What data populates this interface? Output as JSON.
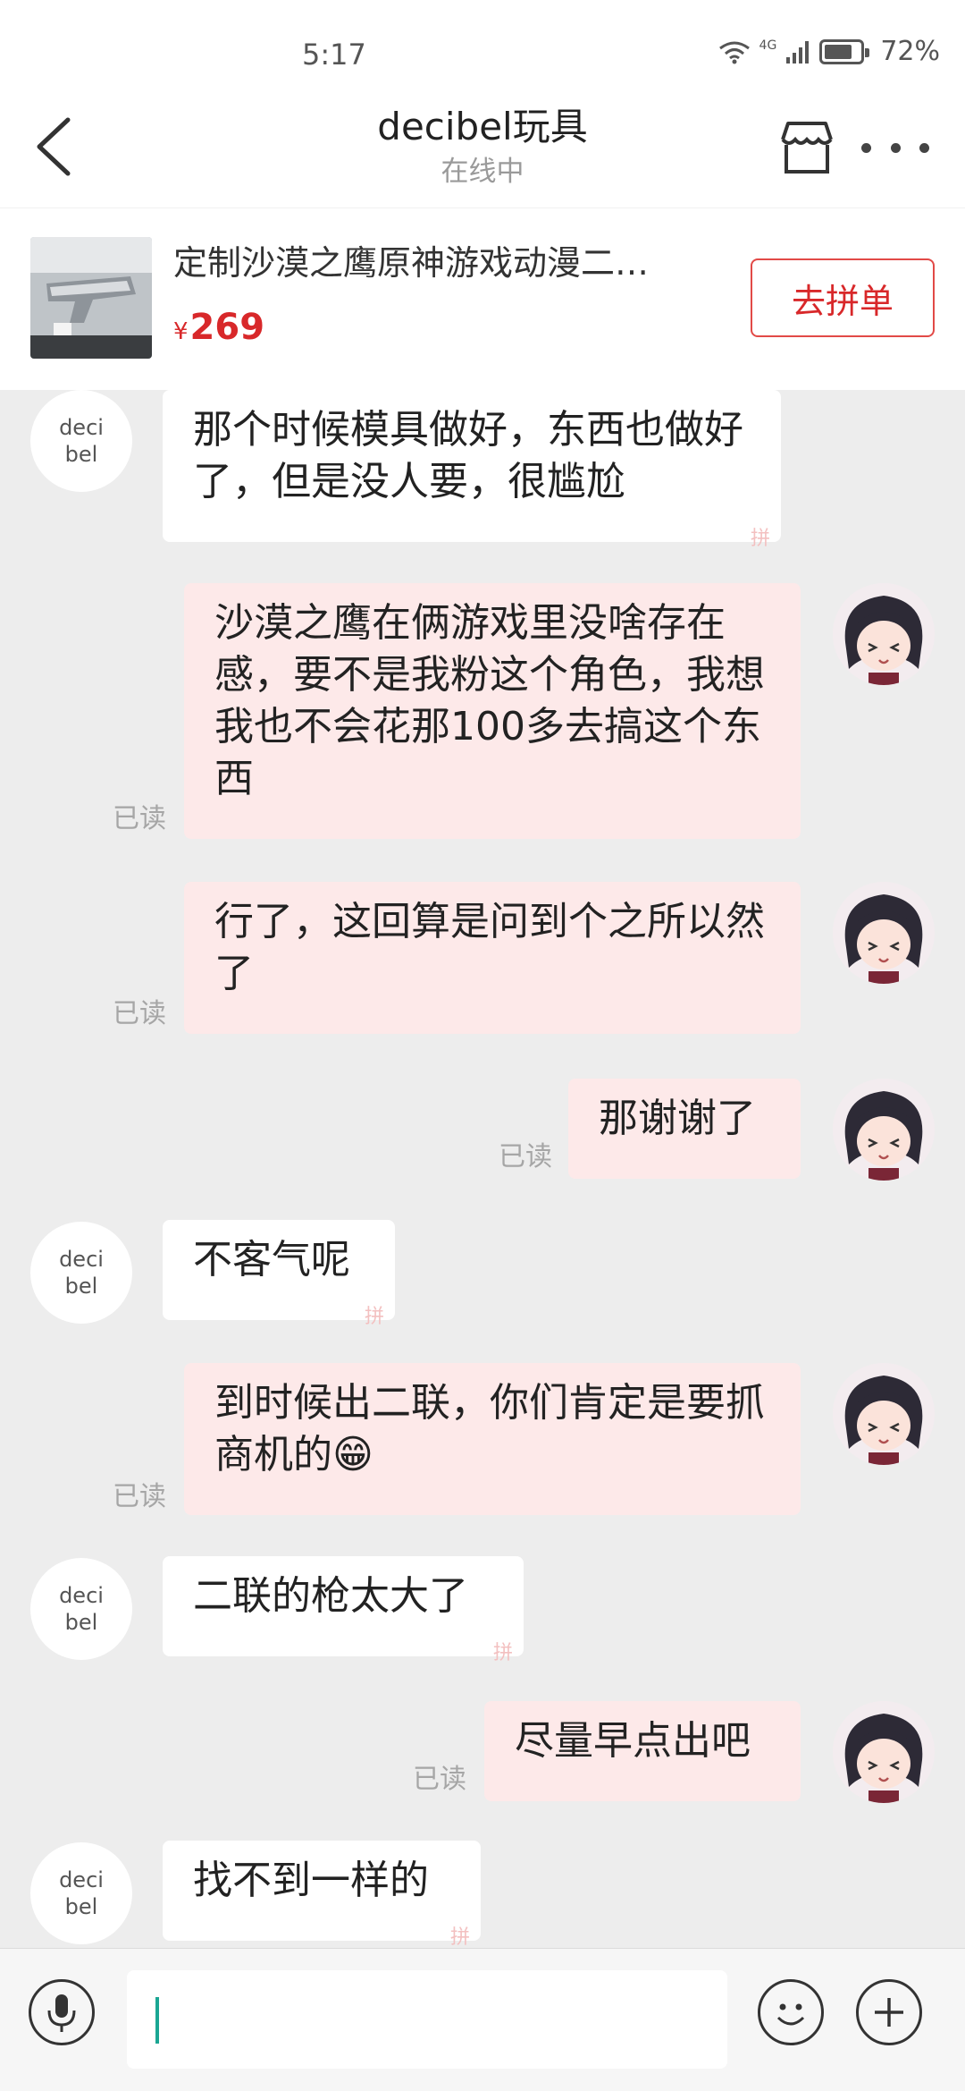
{
  "status_bar": {
    "time": "5:17",
    "network": "4G",
    "battery": "72%"
  },
  "header": {
    "title": "decibel玩具",
    "subtitle": "在线中"
  },
  "product": {
    "name": "定制沙漠之鹰原神游戏动漫二…",
    "currency": "¥",
    "price": "269",
    "button": "去拼单"
  },
  "contact": {
    "avatar_text_line1": "deci",
    "avatar_text_line2": "bel"
  },
  "messages": [
    {
      "side": "in",
      "text": "那个时候模具做好，东西也做好了，但是没人要，很尴尬"
    },
    {
      "side": "out",
      "text": "沙漠之鹰在俩游戏里没啥存在感，要不是我粉这个角色，我想我也不会花那100多去搞这个东西",
      "status": "已读"
    },
    {
      "side": "out",
      "text": "行了，这回算是问到个之所以然了",
      "status": "已读"
    },
    {
      "side": "out",
      "text": "那谢谢了",
      "status": "已读"
    },
    {
      "side": "in",
      "text": "不客气呢"
    },
    {
      "side": "out",
      "text": "到时候出二联，你们肯定是要抓商机的😁",
      "status": "已读"
    },
    {
      "side": "in",
      "text": "二联的枪太大了"
    },
    {
      "side": "out",
      "text": "尽量早点出吧",
      "status": "已读"
    },
    {
      "side": "in",
      "text": "找不到一样的"
    }
  ],
  "input": {
    "value": ""
  },
  "icons": {
    "back": "back-arrow-icon",
    "shop": "store-icon",
    "more": "more-dots-icon",
    "voice": "microphone-icon",
    "emoji": "emoji-icon",
    "plus": "plus-icon",
    "watermark": "pin-watermark-icon"
  },
  "colors": {
    "accent_red": "#d8282a",
    "outgoing_bubble": "#fde9e9",
    "incoming_bubble": "#ffffff",
    "chat_bg": "#ededed",
    "caret": "#1aa693"
  }
}
